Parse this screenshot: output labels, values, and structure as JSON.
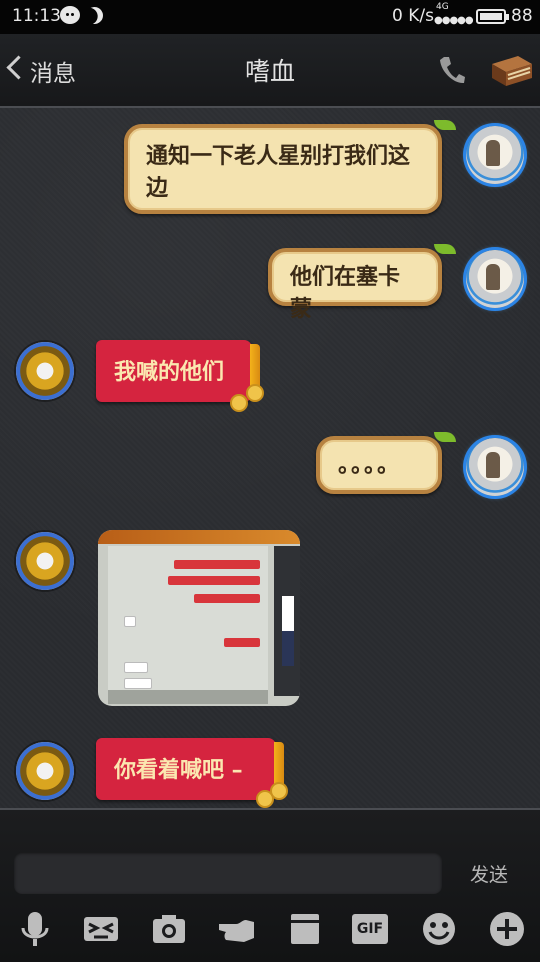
{
  "status_bar": {
    "time": "11:13",
    "speed": "0 K/s",
    "network": "4G",
    "signal_dots": "●●●●●",
    "battery_level": "88"
  },
  "header": {
    "back_label": "消息",
    "title": "嗜血"
  },
  "messages": [
    {
      "side": "right",
      "type": "text",
      "style": "tan",
      "text": "通知一下老人星别打我们这边"
    },
    {
      "side": "right",
      "type": "text",
      "style": "tan",
      "text": "他们在塞卡蒙"
    },
    {
      "side": "left",
      "type": "text",
      "style": "red",
      "text": "我喊的他们"
    },
    {
      "side": "right",
      "type": "text",
      "style": "tan",
      "text": "。。。。"
    },
    {
      "side": "left",
      "type": "image",
      "alt": "screenshot"
    },
    {
      "side": "left",
      "type": "text",
      "style": "red",
      "text": "你看着喊吧 –"
    }
  ],
  "input": {
    "value": "",
    "placeholder": "",
    "send_label": "发送"
  },
  "toolbar": {
    "icons": [
      "microphone-icon",
      "emoticon-sketch-icon",
      "camera-icon",
      "hand-icon",
      "package-icon",
      "gif-icon",
      "smiley-icon",
      "plus-icon"
    ],
    "gif_label": "GIF"
  },
  "colors": {
    "tan_bubble": "#f4e3b0",
    "tan_border": "#b78240",
    "red_bubble": "#d5243f",
    "red_text": "#fbe7b0"
  }
}
